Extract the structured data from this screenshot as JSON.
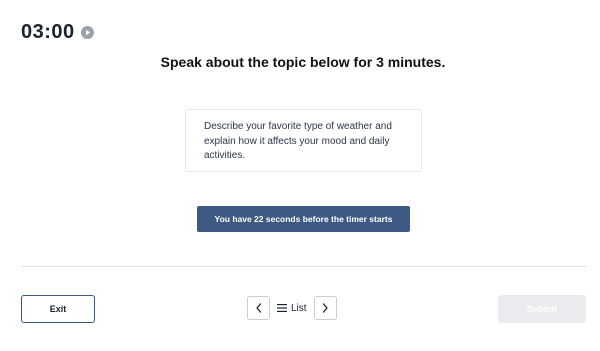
{
  "timer": {
    "display": "03:00",
    "play_icon": "play-circle-icon"
  },
  "heading": "Speak about the topic below for 3 minutes.",
  "prompt": {
    "text": "Describe your favorite type of weather and explain how it affects your mood and daily activities."
  },
  "countdown_banner": "You have 22 seconds before the timer starts",
  "footer": {
    "exit_label": "Exit",
    "list_label": "List",
    "prev_icon": "chevron-left-icon",
    "next_icon": "chevron-right-icon",
    "list_icon": "hamburger-menu-icon",
    "submit_label": "Submit",
    "submit_enabled": false
  },
  "colors": {
    "accent": "#3c5a82",
    "text_dark": "#1a2330",
    "disabled_bg": "#e9ebee",
    "play_icon": "#9aa1ab"
  }
}
